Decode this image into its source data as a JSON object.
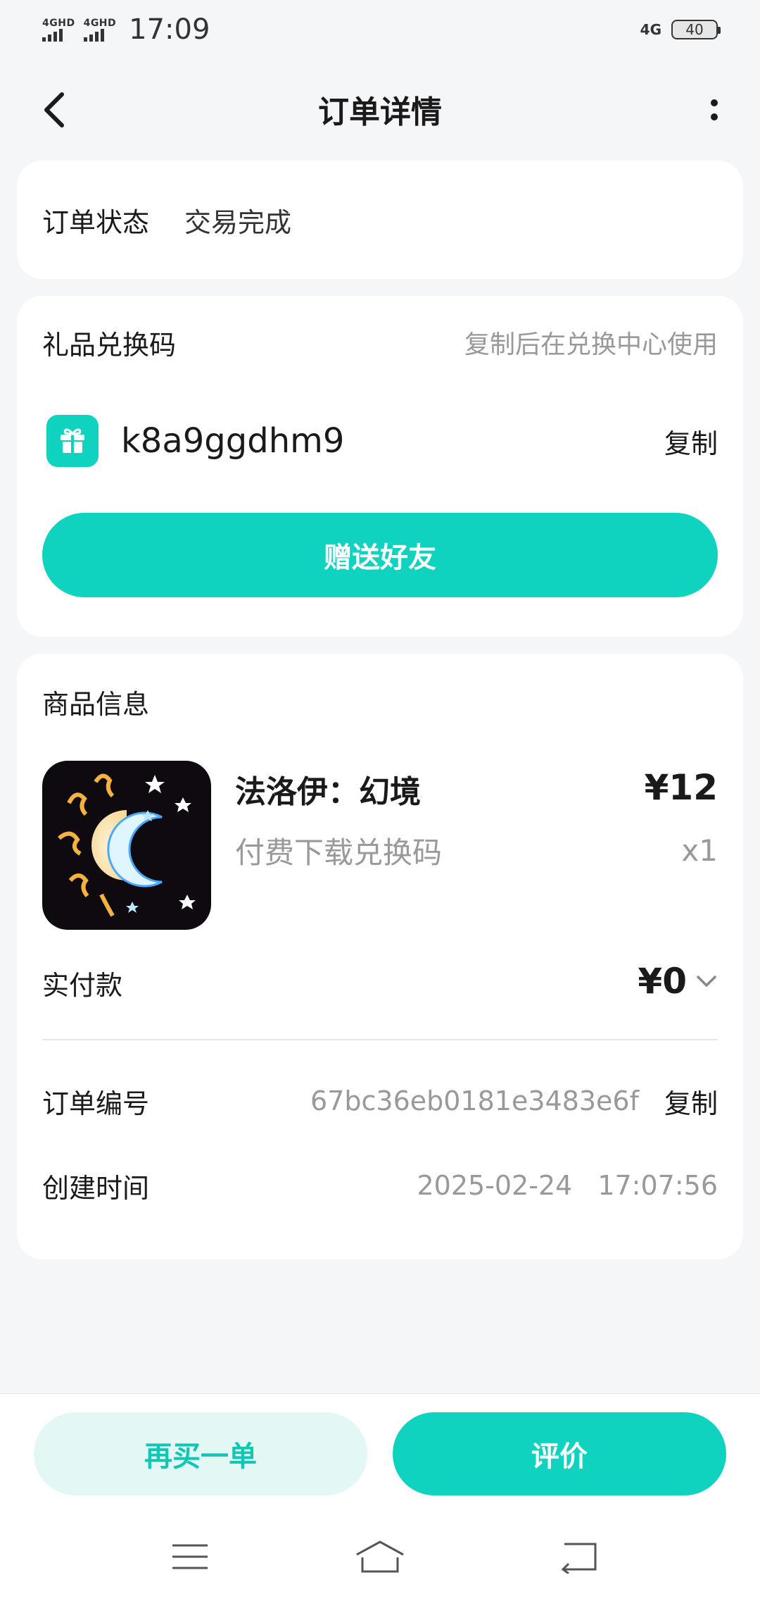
{
  "status_bar": {
    "sim1_label": "4GHD",
    "sim2_label": "4GHD",
    "time": "17:09",
    "network": "4G",
    "battery": "40"
  },
  "header": {
    "title": "订单详情"
  },
  "order_status": {
    "label": "订单状态",
    "value": "交易完成"
  },
  "gift_code": {
    "title": "礼品兑换码",
    "hint": "复制后在兑换中心使用",
    "code": "k8a9ggdhm9",
    "copy_label": "复制",
    "send_button": "赠送好友"
  },
  "product": {
    "section_title": "商品信息",
    "name": "法洛伊：幻境",
    "subtitle": "付费下载兑换码",
    "price": "¥12",
    "quantity": "x1",
    "paid_label": "实付款",
    "paid_value": "¥0"
  },
  "order_info": {
    "number_label": "订单编号",
    "number_value": "67bc36eb0181e3483e6f",
    "number_copy": "复制",
    "created_label": "创建时间",
    "created_date": "2025-02-24",
    "created_time": "17:07:56"
  },
  "actions": {
    "rebuy": "再买一单",
    "rate": "评价"
  },
  "colors": {
    "accent": "#0fd3bf",
    "accent_light": "#e3f8f5",
    "background": "#f5f6f8"
  },
  "icons": [
    "back-icon",
    "more-icon",
    "gift-icon",
    "chevron-down-icon",
    "menu-icon",
    "home-icon",
    "return-icon"
  ]
}
